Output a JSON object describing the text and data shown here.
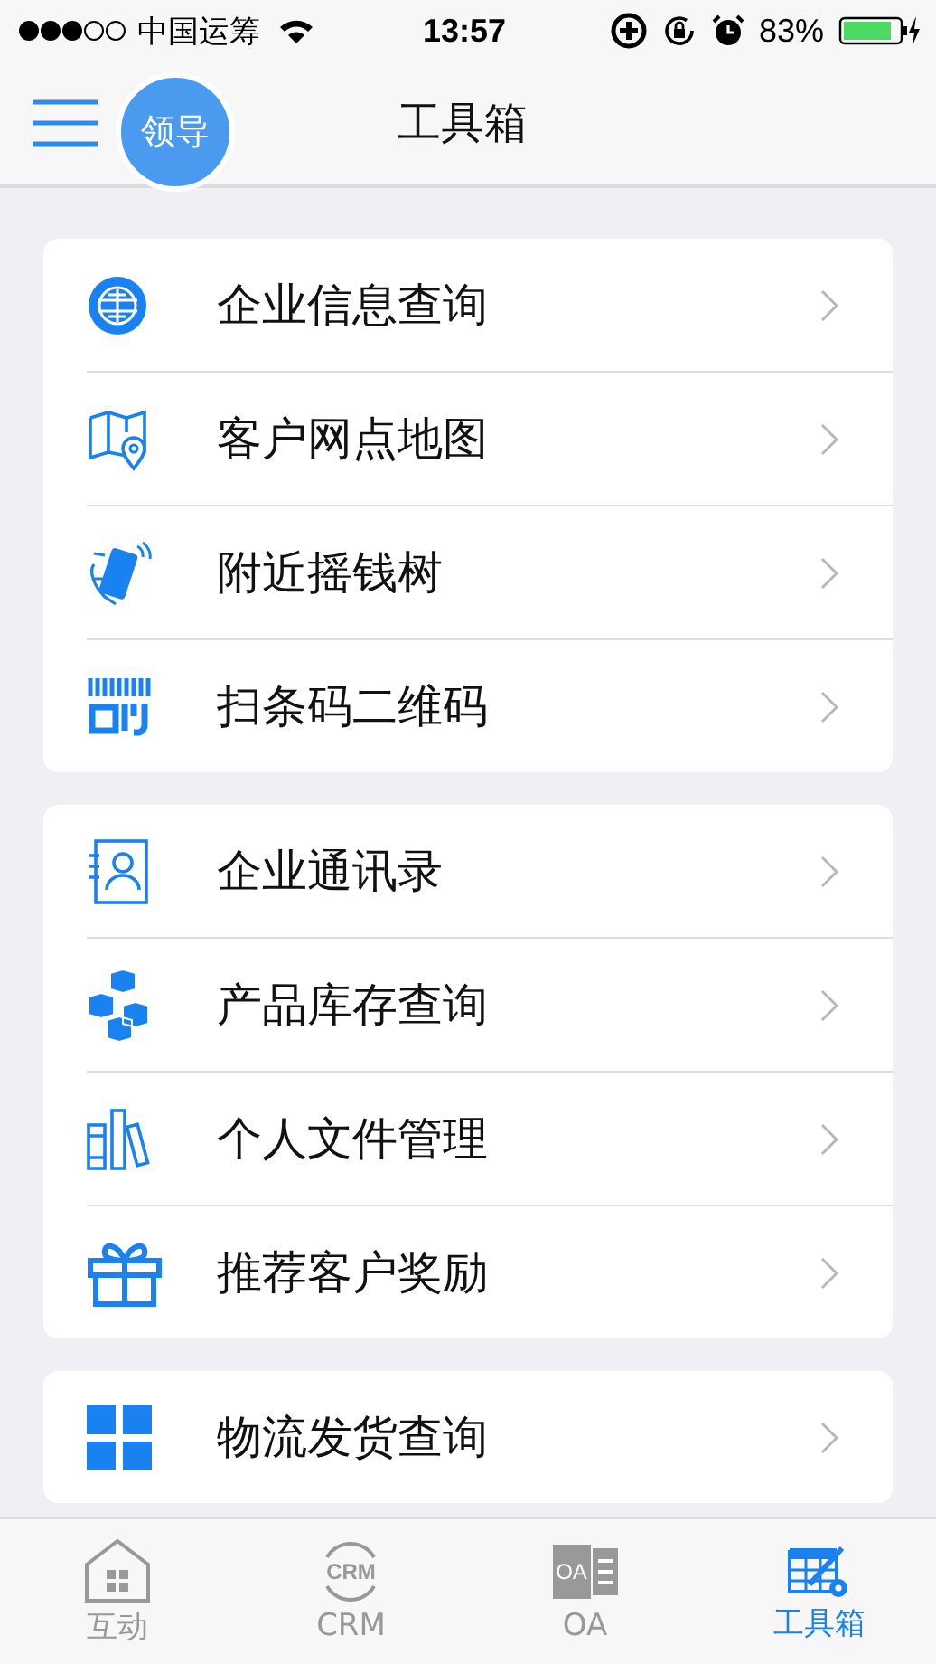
{
  "status_bar": {
    "carrier": "中国运筹",
    "time": "13:57",
    "battery": "83%"
  },
  "nav_bar": {
    "badge": "领导",
    "title": "工具箱"
  },
  "groups": [
    {
      "items": [
        {
          "kind": "company",
          "label": "企业信息查询"
        },
        {
          "kind": "map",
          "label": "客户网点地图"
        },
        {
          "kind": "shake",
          "label": "附近摇钱树"
        },
        {
          "kind": "scan",
          "label": "扫条码二维码"
        }
      ]
    },
    {
      "items": [
        {
          "kind": "contacts",
          "label": "企业通讯录"
        },
        {
          "kind": "boxes",
          "label": "产品库存查询"
        },
        {
          "kind": "files",
          "label": "个人文件管理"
        },
        {
          "kind": "gift",
          "label": "推荐客户奖励"
        }
      ]
    },
    {
      "items": [
        {
          "kind": "grid",
          "label": "物流发货查询"
        }
      ]
    }
  ],
  "tab_bar": [
    {
      "kind": "home",
      "label": "互动",
      "selected": false
    },
    {
      "kind": "crm",
      "icon_text": "CRM",
      "label": "CRM",
      "selected": false
    },
    {
      "kind": "oa",
      "icon_text": "OA",
      "label": "OA",
      "selected": false
    },
    {
      "kind": "tools",
      "label": "工具箱",
      "selected": true
    }
  ]
}
